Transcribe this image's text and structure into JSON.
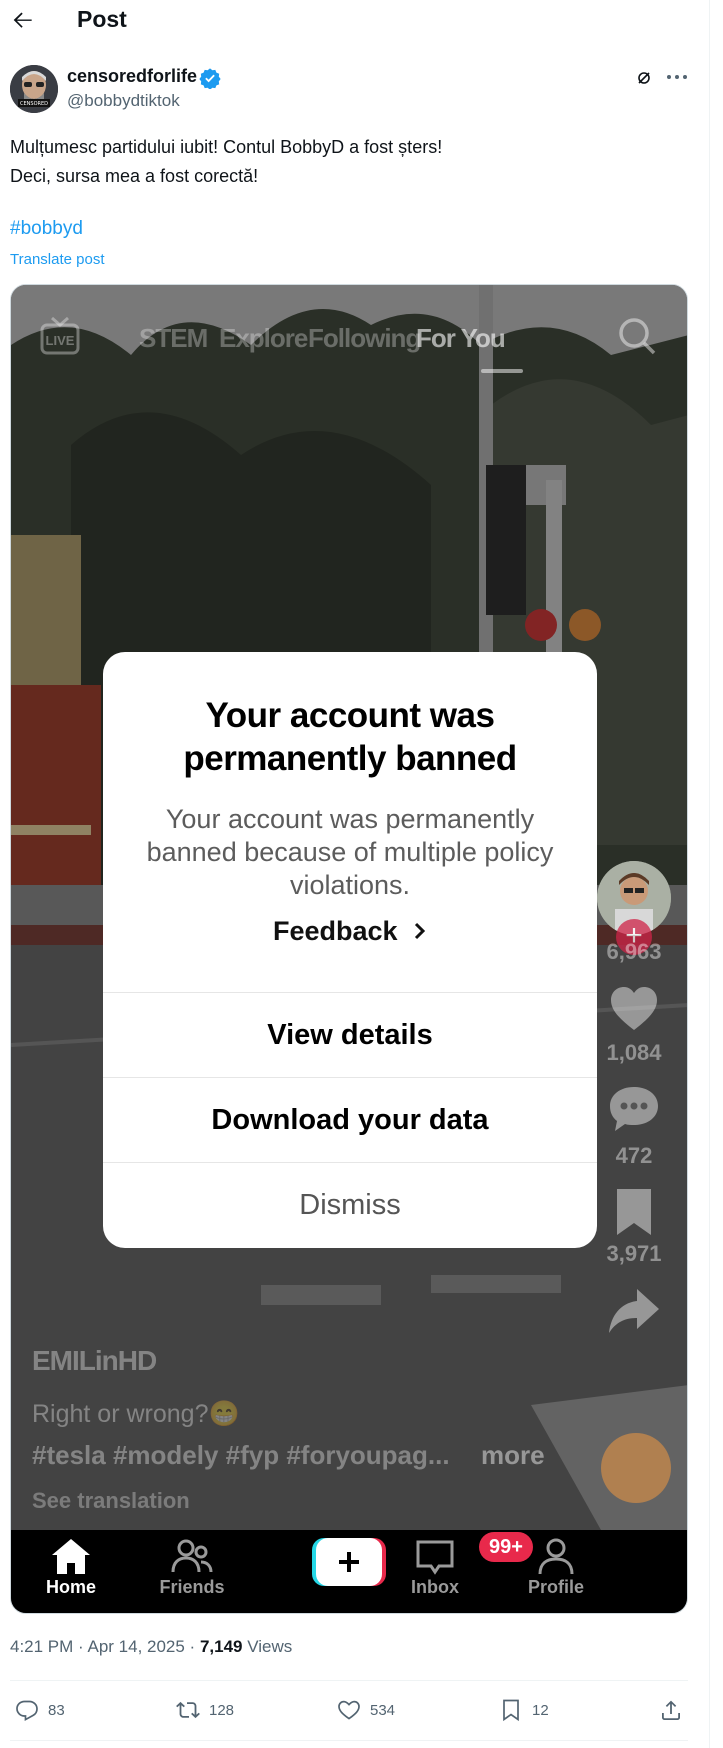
{
  "header": {
    "title": "Post"
  },
  "author": {
    "display_name": "censoredforlife",
    "handle": "@bobbydtiktok",
    "avatar_text": "CENSORED"
  },
  "post": {
    "lines": [
      "Mulțumesc partidului iubit! Contul BobbyD a fost șters!",
      "Deci, sursa mea a fost corectă!"
    ],
    "hashtag": "#bobbyd",
    "translate_label": "Translate post"
  },
  "screenshot": {
    "top_tabs": [
      "STEM",
      "Explore",
      "Following",
      "For You"
    ],
    "active_tab": "For You",
    "live_label": "LIVE",
    "side_counts": {
      "likes": "6,963",
      "comments": "1,084",
      "saves": "472",
      "shares": "3,971"
    },
    "caption": {
      "username": "EMILinHD",
      "text": "Right or wrong?😁",
      "tags": "#tesla #modely #fyp #foryoupag...",
      "more": "more",
      "see_translation": "See translation"
    },
    "modal": {
      "title_line1": "Your account was",
      "title_line2": "permanently banned",
      "body": "Your account was permanently banned because of multiple policy violations.",
      "feedback": "Feedback",
      "view_details": "View details",
      "download": "Download your data",
      "dismiss": "Dismiss"
    },
    "bottom_nav": {
      "home": "Home",
      "friends": "Friends",
      "inbox": "Inbox",
      "inbox_badge": "99+",
      "profile": "Profile"
    }
  },
  "meta": {
    "time": "4:21 PM · Apr 14, 2025 · ",
    "views_count": "7,149",
    "views_label": " Views"
  },
  "actions": {
    "replies": "83",
    "reposts": "128",
    "likes": "534",
    "bookmarks": "12"
  },
  "colors": {
    "accent": "#1d9bf0",
    "verified": "#1d9bf0",
    "tiktok_red": "#e8294b",
    "text_secondary": "#536471"
  }
}
